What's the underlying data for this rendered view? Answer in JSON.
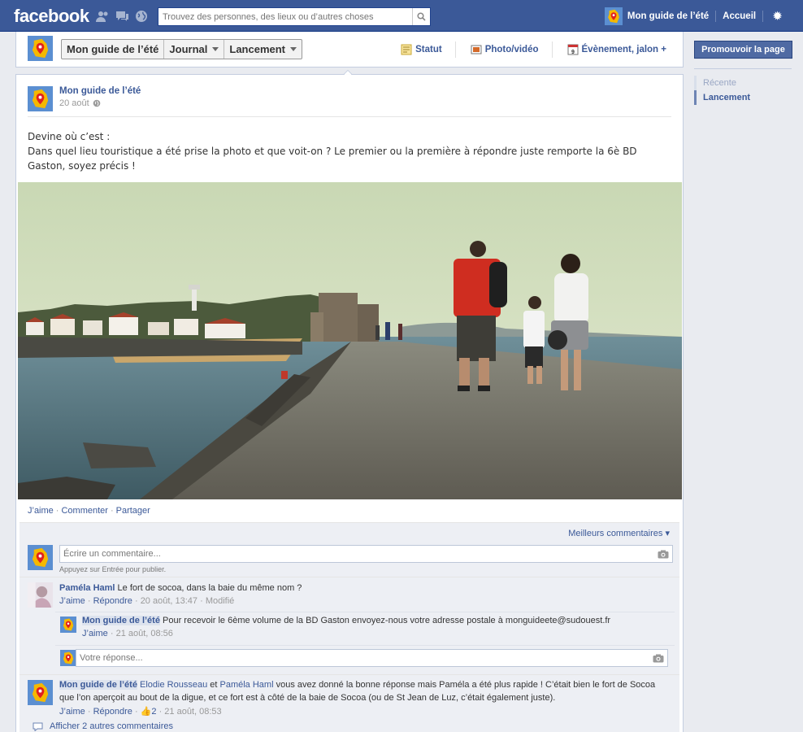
{
  "topbar": {
    "logo": "facebook",
    "search_placeholder": "Trouvez des personnes, des lieux ou d’autres choses",
    "page_name": "Mon guide de l’été",
    "home": "Accueil"
  },
  "page_header": {
    "crumbs": [
      "Mon guide de l’été",
      "Journal",
      "Lancement"
    ],
    "composer": [
      "Statut",
      "Photo/vidéo",
      "Évènement, jalon +"
    ]
  },
  "sidebar": {
    "promote": "Promouvoir la page",
    "nav": [
      "Récente",
      "Lancement"
    ]
  },
  "post": {
    "author": "Mon guide de l’été",
    "date": "20 août",
    "text_line1": "Devine où c’est :",
    "text_line2": "Dans quel lieu touristique a été prise la photo et que voit-on ? Le premier ou la première à répondre juste remporte la 6è BD Gaston, soyez précis !",
    "actions": [
      "J’aime",
      "Commenter",
      "Partager"
    ]
  },
  "comments_area": {
    "sort_label": "Meilleurs commentaires",
    "new_comment_placeholder": "Écrire un commentaire...",
    "hint": "Appuyez sur Entrée pour publier.",
    "comments": [
      {
        "author": "Paméla Haml",
        "text": "Le fort de socoa, dans la baie du même nom ?",
        "like": "J’aime",
        "reply": "Répondre",
        "date": "20 août, 13:47",
        "edited": "Modifié"
      }
    ],
    "reply": {
      "author": "Mon guide de l’été",
      "text": "Pour recevoir le 6ème volume de la BD Gaston envoyez-nous votre adresse postale à monguideete@sudouest.fr",
      "like": "J’aime",
      "date": "21 août, 08:56",
      "reply_placeholder": "Votre réponse..."
    },
    "last_comment": {
      "author": "Mon guide de l’été",
      "mention1": "Elodie Rousseau",
      "and": "et",
      "mention2": "Paméla Haml",
      "text": "vous avez donné la bonne réponse mais Paméla a été plus rapide ! C’était bien le fort de Socoa que l’on aperçoit au bout de la digue, et ce fort est à côté de la baie de Socoa (ou de St Jean de Luz, c’était également juste).",
      "like": "J’aime",
      "reply": "Répondre",
      "like_count": "2",
      "date": "21 août, 08:53"
    },
    "show_more": "Afficher 2 autres commentaires"
  },
  "colors": {
    "brand": "#3b5998",
    "background": "#e9ebf0"
  }
}
